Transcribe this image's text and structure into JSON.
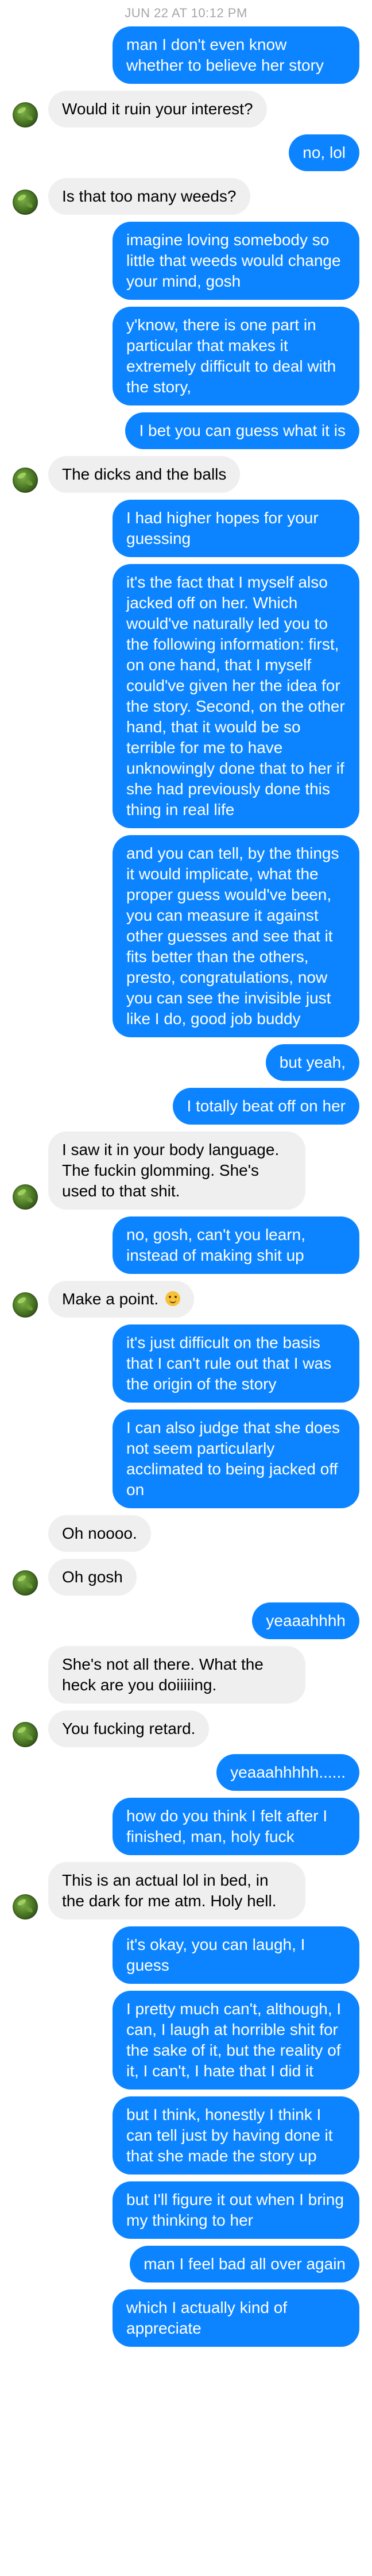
{
  "header": {
    "timestamp": "JUN 22 AT 10:12 PM"
  },
  "colors": {
    "sent_bubble": "#0d84ff",
    "received_bubble": "#efefef",
    "timestamp_text": "#a7a7a7"
  },
  "messages": [
    {
      "dir": "sent",
      "text": "man I don't even know whether to believe her story"
    },
    {
      "dir": "recv",
      "text": "Would it ruin your interest?",
      "avatar": true
    },
    {
      "dir": "sent",
      "text": "no, lol"
    },
    {
      "dir": "recv",
      "text": "Is that too many weeds?",
      "avatar": true
    },
    {
      "dir": "sent",
      "text": "imagine loving somebody so little that weeds would change your mind, gosh"
    },
    {
      "dir": "sent",
      "text": "y'know, there is one part in particular that makes it extremely difficult to deal with the story,"
    },
    {
      "dir": "sent",
      "text": "I bet you can guess what it is"
    },
    {
      "dir": "recv",
      "text": "The dicks and the balls",
      "avatar": true
    },
    {
      "dir": "sent",
      "text": "I had higher hopes for your guessing"
    },
    {
      "dir": "sent",
      "text": "it's the fact that I myself also jacked off on her. Which would've naturally led you to the following information: first, on one hand, that I myself could've given her the idea for the story. Second, on the other hand, that it would be so terrible for me to have unknowingly done that to her if she had previously done this thing in real life"
    },
    {
      "dir": "sent",
      "text": "and you can tell, by the things it would implicate, what the proper guess would've been, you can measure it against other guesses and see that it fits better than the others, presto, congratulations, now you can see the invisible just like I do, good job buddy"
    },
    {
      "dir": "sent",
      "text": "but yeah,"
    },
    {
      "dir": "sent",
      "text": "I totally beat off on her"
    },
    {
      "dir": "recv",
      "text": "I saw it in your body language. The fuckin glomming. She's used to that shit.",
      "avatar": true
    },
    {
      "dir": "sent",
      "text": "no, gosh, can't you learn, instead of making shit up"
    },
    {
      "dir": "recv",
      "text": "Make a point.",
      "avatar": true,
      "emoji": "slightly-smiling-face-emoji"
    },
    {
      "dir": "sent",
      "text": "it's just difficult on the basis that I can't rule out that I was the origin of the story"
    },
    {
      "dir": "sent",
      "text": "I can also judge that she does not seem particularly acclimated to being jacked off on"
    },
    {
      "dir": "recv",
      "text": "Oh noooo.",
      "avatar": false
    },
    {
      "dir": "recv",
      "text": "Oh gosh",
      "avatar": true
    },
    {
      "dir": "sent",
      "text": "yeaaahhhh"
    },
    {
      "dir": "recv",
      "text": "She's not all there. What the heck are you doiiiiing.",
      "avatar": false
    },
    {
      "dir": "recv",
      "text": "You fucking retard.",
      "avatar": true
    },
    {
      "dir": "sent",
      "text": "yeaaahhhhh......"
    },
    {
      "dir": "sent",
      "text": "how do you think I felt after I finished, man, holy fuck"
    },
    {
      "dir": "recv",
      "text": "This is an actual lol in bed, in the dark for me atm. Holy hell.",
      "avatar": true
    },
    {
      "dir": "sent",
      "text": "it's okay, you can laugh, I guess"
    },
    {
      "dir": "sent",
      "text": "I pretty much can't, although, I can, I laugh at horrible shit for the sake of it, but the reality of it, I can't, I hate that I did it"
    },
    {
      "dir": "sent",
      "text": "but I think, honestly I think I can tell just by having done it that she made the story up"
    },
    {
      "dir": "sent",
      "text": "but I'll figure it out when I bring my thinking to her"
    },
    {
      "dir": "sent",
      "text": "man I feel bad all over again"
    },
    {
      "dir": "sent",
      "text": "which I actually kind of appreciate"
    }
  ]
}
